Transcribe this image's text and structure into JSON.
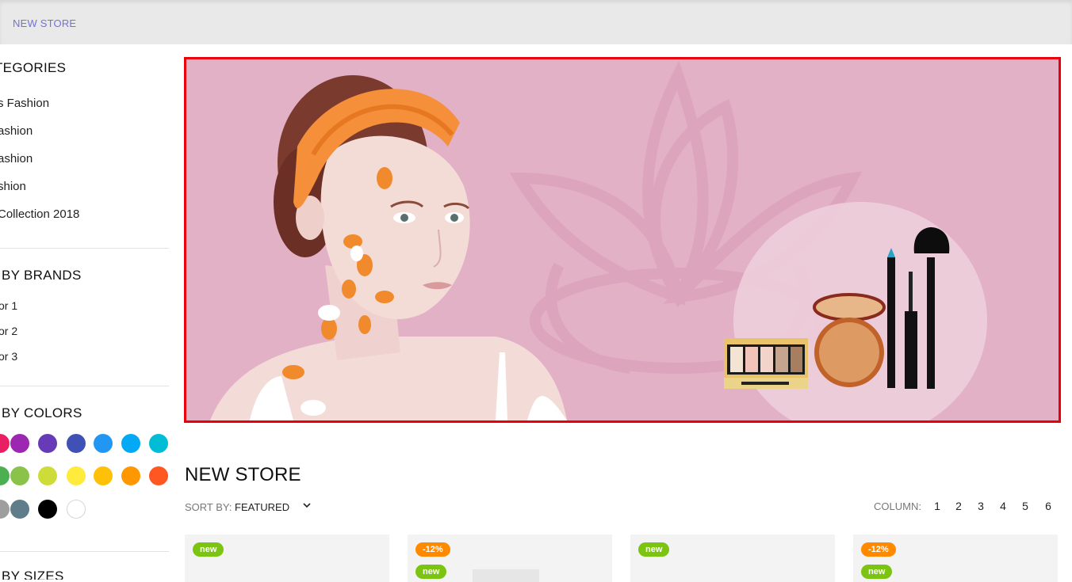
{
  "breadcrumb": {
    "separator": "›",
    "current": "NEW STORE"
  },
  "sidebar": {
    "categories": {
      "title": "TEGORIES",
      "items": [
        "s Fashion",
        "ashion",
        "ashion",
        "shion",
        "Collection 2018"
      ]
    },
    "brands": {
      "title": "BY BRANDS",
      "items": [
        "or 1",
        "or 2",
        "or 3"
      ]
    },
    "colors": {
      "title": "BY COLORS",
      "swatches": [
        "#e91e63",
        "#9c27b0",
        "#673ab7",
        "#3f51b5",
        "#2196f3",
        "#03a9f4",
        "#00bcd4",
        "#4caf50",
        "#8bc34a",
        "#cddc39",
        "#ffeb3b",
        "#ffc107",
        "#ff9800",
        "#ff5722",
        "#9e9e9e",
        "#607d8b",
        "#000000",
        "#ffffff"
      ]
    },
    "sizes": {
      "title": "BY SIZES"
    }
  },
  "banner": {
    "background": "#e2b1c6",
    "border_color": "#e8000b",
    "image_description_icon": "cosmetics-banner"
  },
  "store": {
    "title": "NEW STORE",
    "sort_label": "SORT BY:",
    "sort_value": "FEATURED",
    "column_label": "COLUMN:",
    "columns": [
      "1",
      "2",
      "3",
      "4",
      "5",
      "6"
    ]
  },
  "products": [
    {
      "badges": [
        {
          "type": "new",
          "text": "new"
        }
      ]
    },
    {
      "badges": [
        {
          "type": "sale",
          "text": "-12%"
        },
        {
          "type": "new",
          "text": "new"
        }
      ]
    },
    {
      "badges": [
        {
          "type": "new",
          "text": "new"
        }
      ]
    },
    {
      "badges": [
        {
          "type": "sale",
          "text": "-12%"
        },
        {
          "type": "new",
          "text": "new"
        }
      ]
    }
  ],
  "colors": {
    "accent_link": "#6f74d8",
    "badge_new": "#7cc412",
    "badge_sale": "#ff8a00"
  }
}
